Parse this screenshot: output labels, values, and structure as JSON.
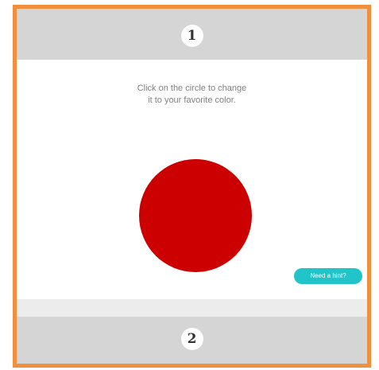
{
  "steps": {
    "first": "1",
    "second": "2"
  },
  "instructions": {
    "line1": "Click on the circle to change",
    "line2": "it to your favorite color."
  },
  "circle": {
    "color": "#cc0000"
  },
  "help_button": {
    "label": "Need a hint?",
    "color": "#21c4c8"
  },
  "colors": {
    "frame": "#f0903c",
    "header": "#d5d5d5"
  }
}
